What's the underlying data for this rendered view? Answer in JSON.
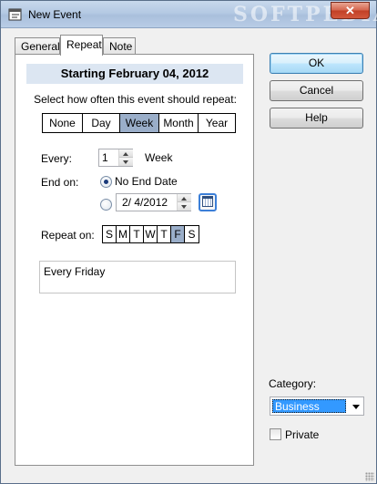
{
  "window": {
    "title": "New Event",
    "watermark": "SOFTPEDIA",
    "close_glyph": "✕"
  },
  "tabs": [
    {
      "label": "General",
      "active": false
    },
    {
      "label": "Repeat",
      "active": true
    },
    {
      "label": "Note",
      "active": false
    }
  ],
  "repeat": {
    "header": "Starting February 04, 2012",
    "prompt": "Select how often this event should repeat:",
    "frequencies": [
      "None",
      "Day",
      "Week",
      "Month",
      "Year"
    ],
    "selected_frequency": "Week",
    "every_label": "Every:",
    "every_value": "1",
    "every_unit": "Week",
    "end_on_label": "End on:",
    "no_end_label": "No End Date",
    "end_date_value": "2/ 4/2012",
    "repeat_on_label": "Repeat on:",
    "days": [
      "S",
      "M",
      "T",
      "W",
      "T",
      "F",
      "S"
    ],
    "selected_day_index": 5,
    "summary": "Every Friday"
  },
  "buttons": {
    "ok": "OK",
    "cancel": "Cancel",
    "help": "Help"
  },
  "category": {
    "label": "Category:",
    "value": "Business"
  },
  "private_label": "Private",
  "colors": {
    "selected_segment": "#9aaec9",
    "header_bg": "#dce6f2",
    "combo_highlight": "#3399ff"
  },
  "icons": [
    "new-event-app-icon",
    "close-icon",
    "calendar-icon",
    "spin-up-icon",
    "spin-down-icon",
    "dropdown-arrow-icon",
    "resize-grip-icon"
  ]
}
